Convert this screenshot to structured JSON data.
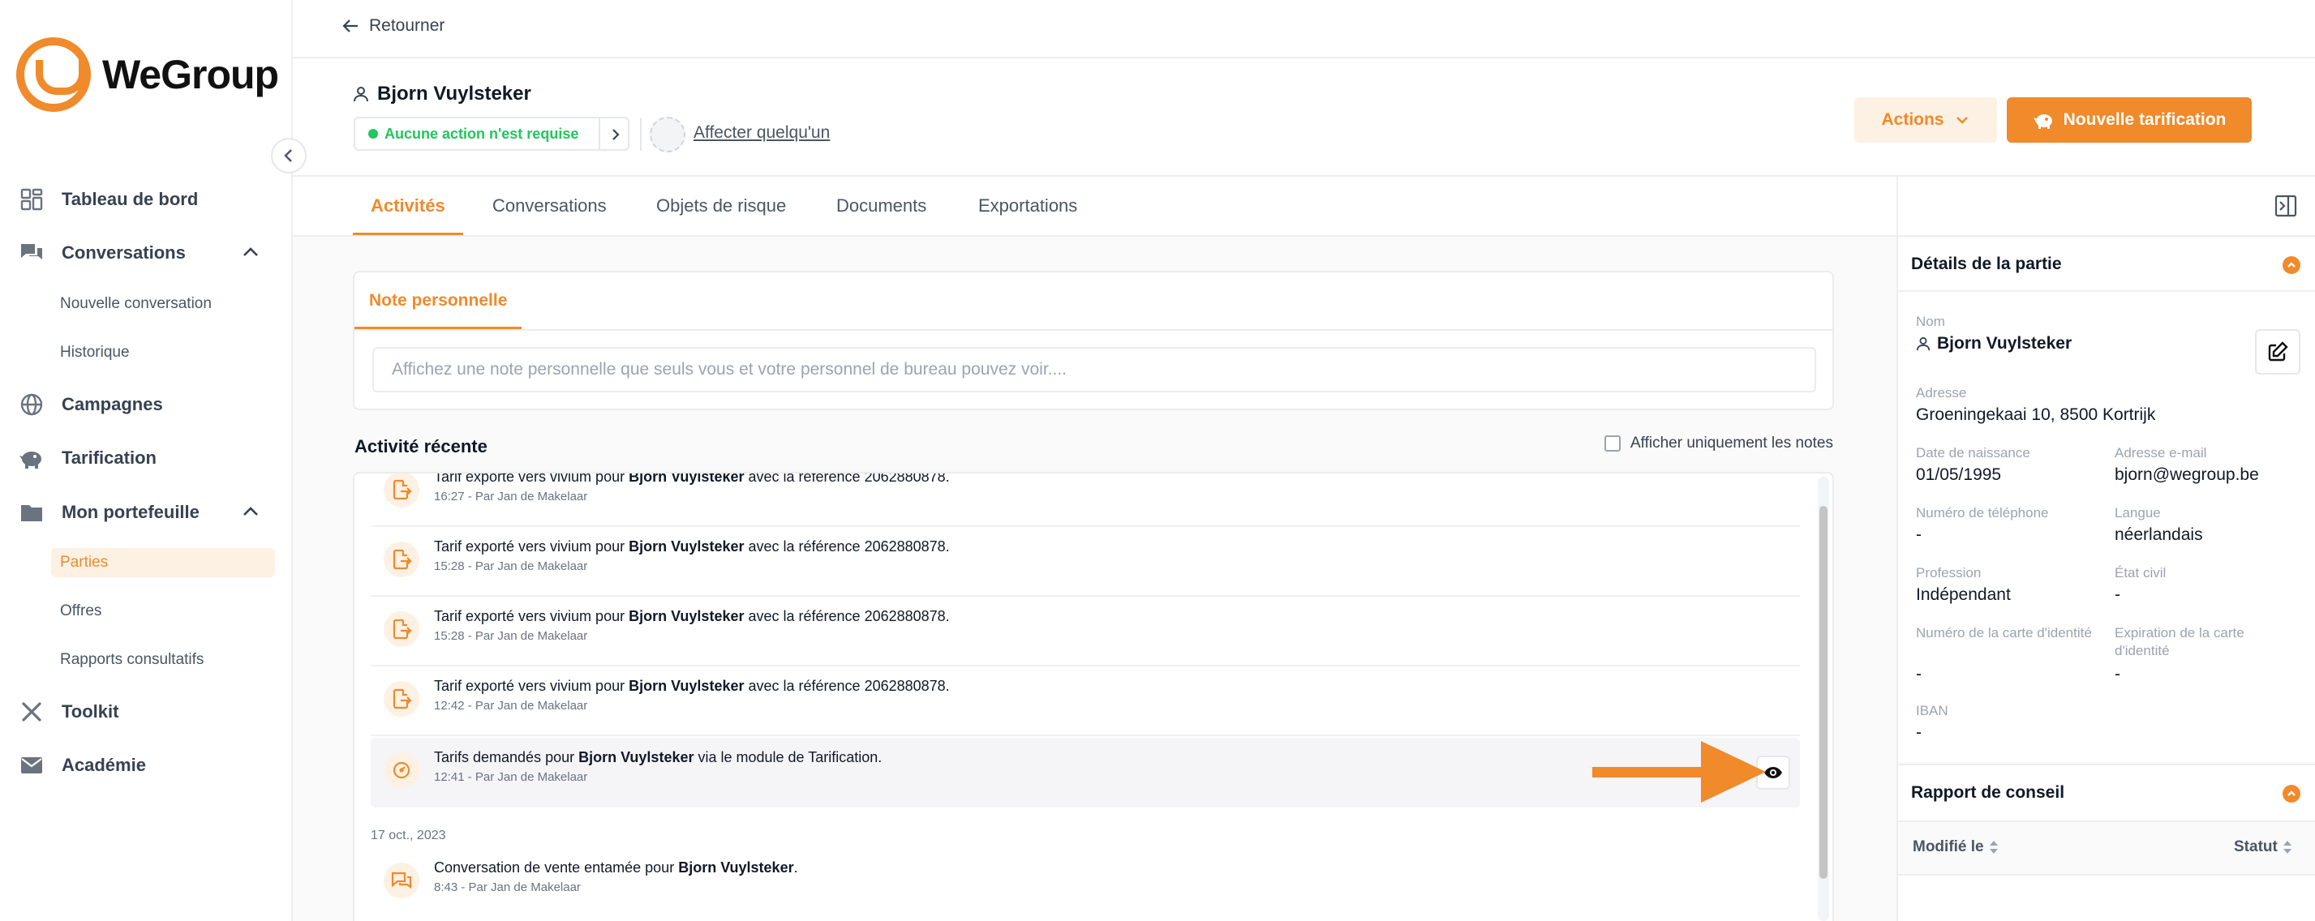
{
  "app": {
    "name": "WeGroup"
  },
  "sidebar": {
    "items": [
      {
        "label": "Tableau de bord",
        "icon": "dashboard-icon"
      },
      {
        "label": "Conversations",
        "icon": "chat-icon",
        "expanded": true,
        "children": [
          {
            "label": "Nouvelle conversation"
          },
          {
            "label": "Historique"
          }
        ]
      },
      {
        "label": "Campagnes",
        "icon": "globe-icon"
      },
      {
        "label": "Tarification",
        "icon": "piggy-bank-icon"
      },
      {
        "label": "Mon portefeuille",
        "icon": "folder-icon",
        "expanded": true,
        "children": [
          {
            "label": "Parties",
            "active": true
          },
          {
            "label": "Offres"
          },
          {
            "label": "Rapports consultatifs"
          }
        ]
      },
      {
        "label": "Toolkit",
        "icon": "tools-icon"
      },
      {
        "label": "Académie",
        "icon": "mail-icon"
      }
    ]
  },
  "topbar": {
    "back_label": "Retourner"
  },
  "header": {
    "party_name": "Bjorn Vuylsteker",
    "status": "Aucune action n'est requise",
    "assign_label": "Affecter quelqu'un",
    "actions_label": "Actions",
    "new_pricing_label": "Nouvelle tarification"
  },
  "tabs": [
    {
      "label": "Activités",
      "active": true
    },
    {
      "label": "Conversations"
    },
    {
      "label": "Objets de risque"
    },
    {
      "label": "Documents"
    },
    {
      "label": "Exportations"
    }
  ],
  "note": {
    "tab_label": "Note personnelle",
    "placeholder": "Affichez une note personnelle que seuls vous et votre personnel de bureau pouvez voir...."
  },
  "activity": {
    "title": "Activité récente",
    "only_notes_label": "Afficher uniquement les notes",
    "items": [
      {
        "prefix": "Tarif exporté vers vivium pour ",
        "bold": "Bjorn Vuylsteker",
        "suffix": " avec la référence 2062880878.",
        "meta": "16:27 - Par Jan de Makelaar",
        "icon": "export-icon"
      },
      {
        "prefix": "Tarif exporté vers vivium pour ",
        "bold": "Bjorn Vuylsteker",
        "suffix": " avec la référence 2062880878.",
        "meta": "15:28 - Par Jan de Makelaar",
        "icon": "export-icon"
      },
      {
        "prefix": "Tarif exporté vers vivium pour ",
        "bold": "Bjorn Vuylsteker",
        "suffix": " avec la référence 2062880878.",
        "meta": "15:28 - Par Jan de Makelaar",
        "icon": "export-icon"
      },
      {
        "prefix": "Tarif exporté vers vivium pour ",
        "bold": "Bjorn Vuylsteker",
        "suffix": " avec la référence 2062880878.",
        "meta": "12:42 - Par Jan de Makelaar",
        "icon": "export-icon"
      },
      {
        "prefix": "Tarifs demandés pour ",
        "bold": "Bjorn Vuylsteker",
        "suffix": " via le module de Tarification.",
        "meta": "12:41 - Par Jan de Makelaar",
        "icon": "pricing-icon",
        "highlighted": true
      }
    ],
    "date_group": "17 oct., 2023",
    "later_items": [
      {
        "prefix": "Conversation de vente entamée pour ",
        "bold": "Bjorn Vuylsteker",
        "suffix": ".",
        "meta": "8:43 - Par Jan de Makelaar",
        "icon": "chat-icon"
      }
    ]
  },
  "party_details": {
    "title": "Détails de la partie",
    "fields": {
      "name": {
        "label": "Nom",
        "value": "Bjorn Vuylsteker"
      },
      "address": {
        "label": "Adresse",
        "value": "Groeningekaai 10, 8500 Kortrijk"
      },
      "birthdate": {
        "label": "Date de naissance",
        "value": "01/05/1995"
      },
      "email": {
        "label": "Adresse e-mail",
        "value": "bjorn@wegroup.be"
      },
      "phone": {
        "label": "Numéro de téléphone",
        "value": "-"
      },
      "language": {
        "label": "Langue",
        "value": "néerlandais"
      },
      "profession": {
        "label": "Profession",
        "value": "Indépendant"
      },
      "civil_status": {
        "label": "État civil",
        "value": "-"
      },
      "id_number": {
        "label": "Numéro de la carte d'identité",
        "value": "-"
      },
      "id_expiry": {
        "label": "Expiration de la carte d'identité",
        "value": "-"
      },
      "iban": {
        "label": "IBAN",
        "value": "-"
      }
    }
  },
  "advice_report": {
    "title": "Rapport de conseil",
    "columns": [
      "Modifié le",
      "Statut"
    ]
  },
  "colors": {
    "accent": "#f08a2a",
    "accent_light": "#fdf1e4",
    "success": "#22c55e"
  }
}
